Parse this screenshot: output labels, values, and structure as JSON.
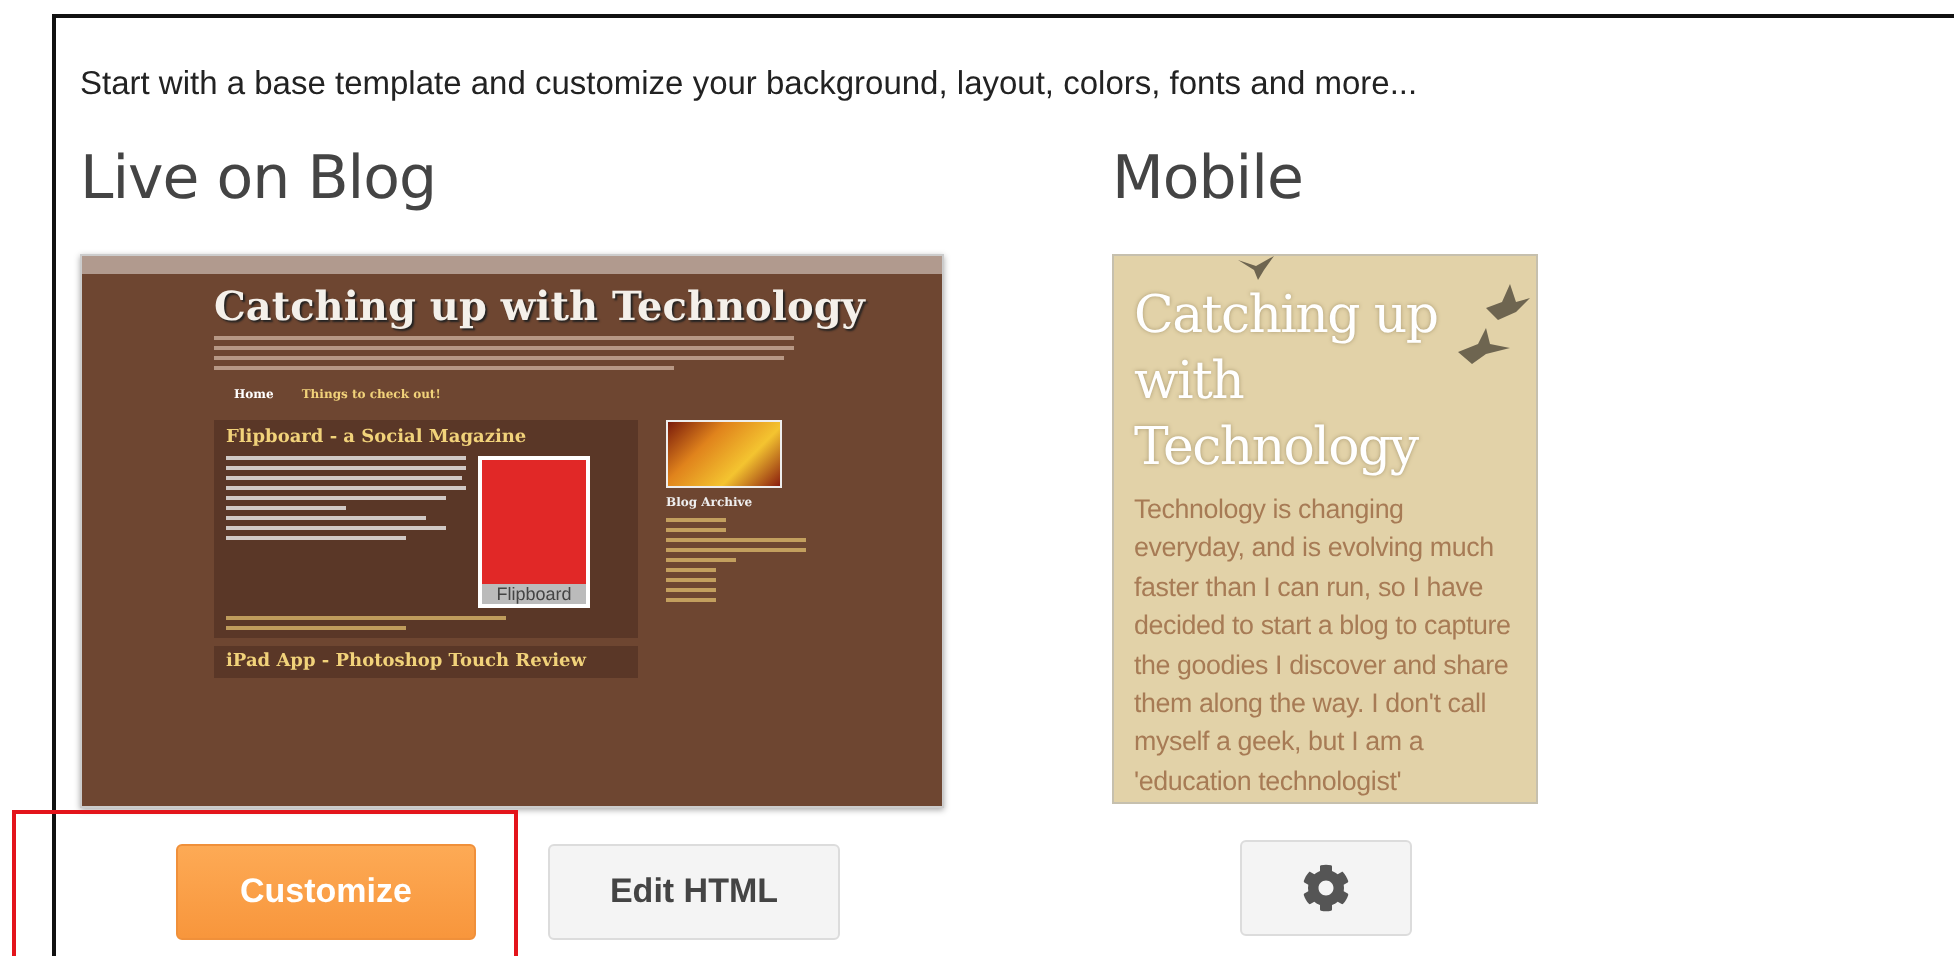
{
  "intro": "Start with a base template and customize your background, layout, colors, fonts and more...",
  "live": {
    "heading": "Live on Blog",
    "preview": {
      "title": "Catching up with Technology",
      "nav": [
        {
          "label": "Home",
          "selected": true
        },
        {
          "label": "Things to check out!",
          "selected": false
        }
      ],
      "post_title": "Flipboard - a Social Magazine",
      "logo_text": "Flipboard",
      "sidebar_heading": "Blog Archive",
      "next_post_title": "iPad App - Photoshop Touch Review"
    },
    "buttons": [
      {
        "label": "Customize",
        "kind": "primary",
        "highlighted": true
      },
      {
        "label": "Edit HTML",
        "kind": "secondary"
      }
    ]
  },
  "mobile": {
    "heading": "Mobile",
    "preview": {
      "title": "Catching up with Technology",
      "text": "Technology is changing everyday, and is evolving much faster than I can run, so I have decided to start a blog to capture the goodies I discover and share them along the way. I don't call myself a geek, but I am a 'education technologist'"
    },
    "buttons": [
      {
        "kind": "settings"
      }
    ]
  }
}
